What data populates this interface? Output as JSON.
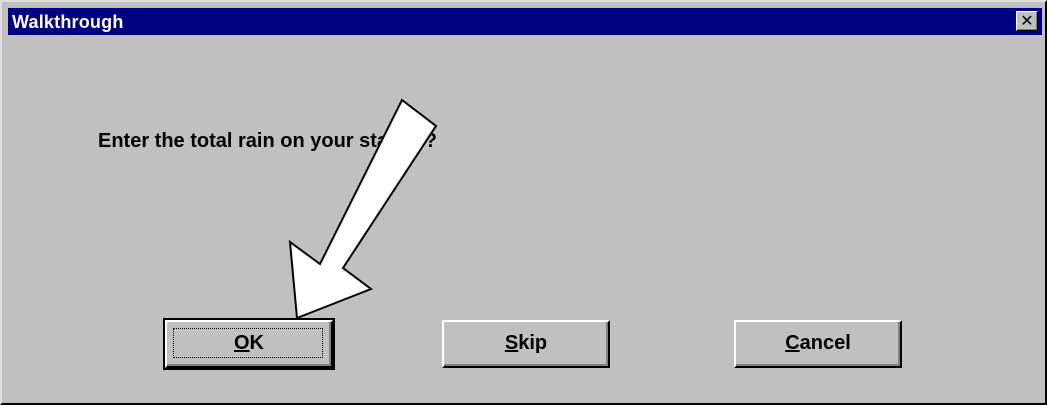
{
  "window": {
    "title": "Walkthrough",
    "close_icon": "close-icon",
    "close_glyph": "✕"
  },
  "dialog": {
    "prompt": "Enter the total rain on your station?"
  },
  "buttons": {
    "ok": {
      "accel": "O",
      "rest": "K"
    },
    "skip": {
      "accel": "S",
      "rest": "kip"
    },
    "cancel": {
      "accel": "C",
      "rest": "ancel"
    }
  },
  "annotation": {
    "icon": "pointer-arrow-icon",
    "fill": "#ffffff",
    "stroke": "#000000"
  },
  "colors": {
    "titlebar": "#000080",
    "face": "#c0c0c0"
  }
}
